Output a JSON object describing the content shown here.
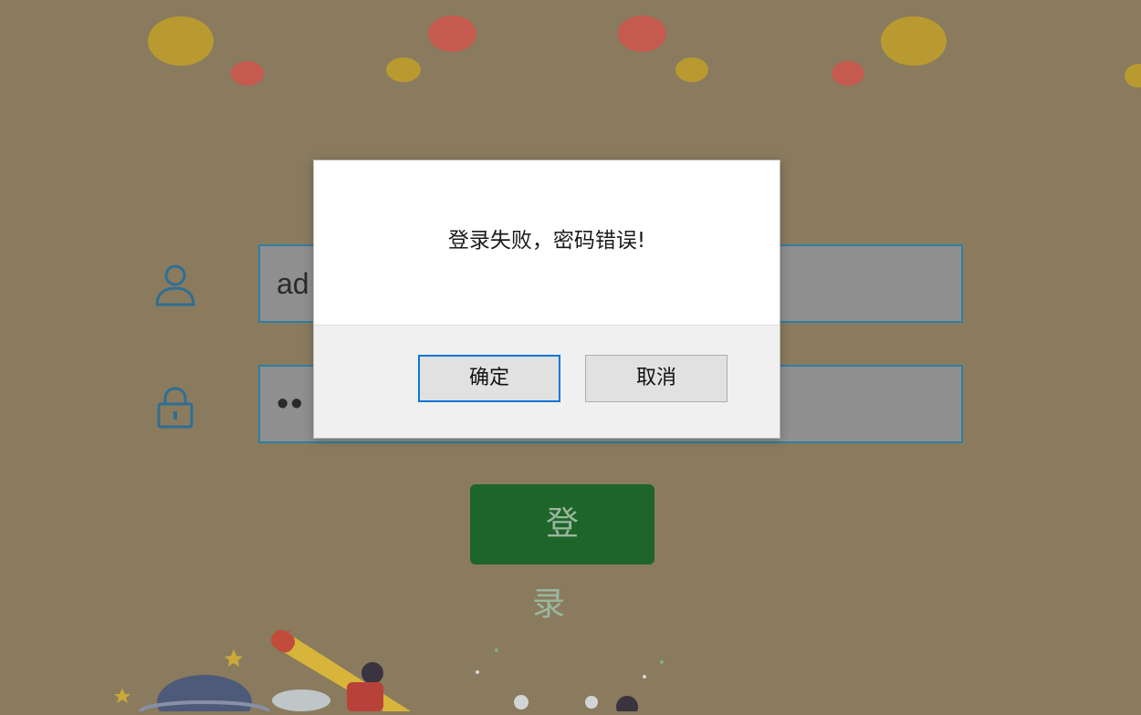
{
  "login_form": {
    "username_value": "ad",
    "password_value": "••",
    "login_button_label": "登　录"
  },
  "dialog": {
    "message": "登录失败，密码错误!",
    "ok_label": "确定",
    "cancel_label": "取消"
  },
  "icons": {
    "username": "user-icon",
    "password": "lock-icon"
  },
  "colors": {
    "background": "#8a7b5e",
    "login_button": "#1e6529",
    "field_border": "#2f7fa3",
    "ok_focus_border": "#0a76d8"
  }
}
